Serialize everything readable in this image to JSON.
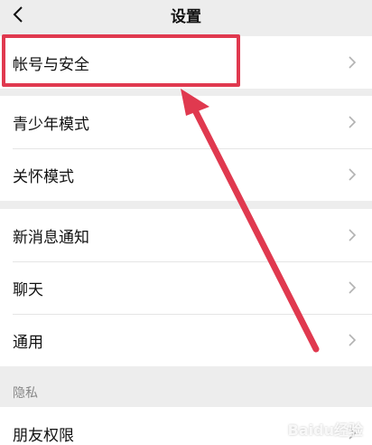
{
  "header": {
    "title": "设置",
    "back_icon": "chevron-left-icon"
  },
  "groups": [
    {
      "items": [
        {
          "label": "帐号与安全"
        }
      ]
    },
    {
      "items": [
        {
          "label": "青少年模式"
        },
        {
          "label": "关怀模式"
        }
      ]
    },
    {
      "items": [
        {
          "label": "新消息通知"
        },
        {
          "label": "聊天"
        },
        {
          "label": "通用"
        }
      ]
    }
  ],
  "privacy": {
    "section_title": "隐私",
    "items": [
      {
        "label": "朋友权限"
      }
    ]
  },
  "annotation": {
    "highlight_color": "#e0394f"
  },
  "watermark": "Baidu经验"
}
